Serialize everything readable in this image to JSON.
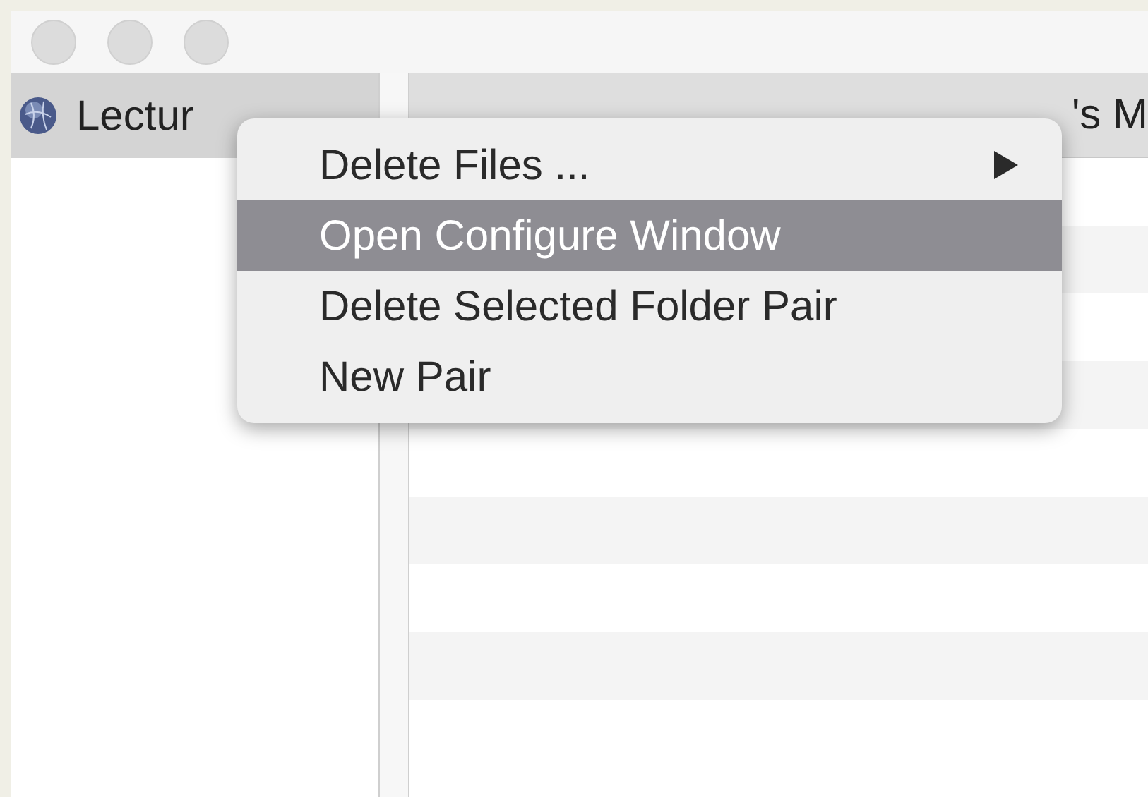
{
  "sidebar": {
    "items": [
      {
        "label": "Lectur",
        "selected": true
      }
    ]
  },
  "table": {
    "header": {
      "column_1": "'s M"
    }
  },
  "context_menu": {
    "items": [
      {
        "label": "Delete Files ...",
        "selected": false,
        "submenu": true
      },
      {
        "label": "Open Configure Window",
        "selected": true,
        "submenu": false
      },
      {
        "label": "Delete Selected Folder Pair",
        "selected": false,
        "submenu": false
      },
      {
        "label": "New Pair",
        "selected": false,
        "submenu": false
      }
    ]
  }
}
